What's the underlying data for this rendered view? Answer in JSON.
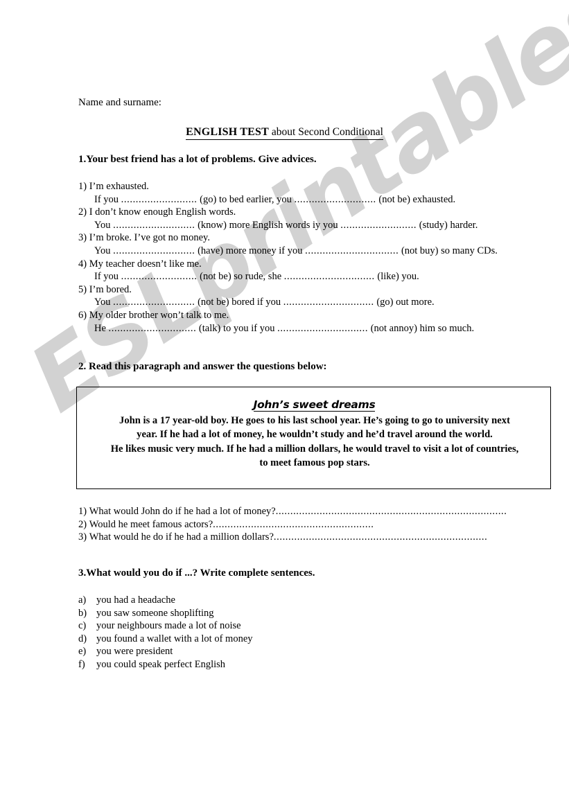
{
  "page": {
    "name_field_label": "Name and surname:",
    "watermark": "ESLprintables.com"
  },
  "title": {
    "strong": "ENGLISH TEST",
    "light": " about Second Conditional"
  },
  "exercise1": {
    "heading": "1.Your best friend has a lot of problems. Give advices.",
    "items": [
      {
        "number": "1)",
        "problem": "I’m exhausted.",
        "answer_pre": "If you ",
        "dots1": "..........................",
        "answer_mid": " (go) to bed earlier, you ",
        "dots2": "............................",
        "answer_post": " (not be) exhausted."
      },
      {
        "number": "2)",
        "problem": "I don’t know enough English words.",
        "answer_pre": "You ",
        "dots1": "............................",
        "answer_mid": " (know) more English words iy you ",
        "dots2": "..........................",
        "answer_post": " (study)   harder."
      },
      {
        "number": "3)",
        "problem": "I’m broke. I’ve got no money.",
        "answer_pre": "You ",
        "dots1": "............................",
        "answer_mid": " (have) more money if you ",
        "dots2": "................................",
        "answer_post": " (not buy) so many CDs."
      },
      {
        "number": "4)",
        "problem": "My teacher doesn’t like me.",
        "answer_pre": "If you ",
        "dots1": "..........................",
        "answer_mid": " (not be) so rude, she ",
        "dots2": "...............................",
        "answer_post": " (like) you."
      },
      {
        "number": "5)",
        "problem": "I’m bored.",
        "answer_pre": "You ",
        "dots1": "............................",
        "answer_mid": " (not be) bored if you ",
        "dots2": "...............................",
        "answer_post": " (go) out more."
      },
      {
        "number": "6)",
        "problem": "My older brother won’t talk to me.",
        "answer_pre": "He ",
        "dots1": "..............................",
        "answer_mid": " (talk) to you if you ",
        "dots2": "...............................",
        "answer_post": " (not annoy) him so much."
      }
    ]
  },
  "exercise2": {
    "heading": "2.   Read this paragraph and answer the questions below:",
    "box": {
      "title": "John’s  sweet dreams",
      "paragraph": [
        "John is a 17 year-old boy. He goes to his last school year. He’s going to go to university next year. If he had a lot of money, he wouldn’t study and he’d travel around the world.",
        "He likes music very much. If he had a million dollars, he would travel to visit a lot of countries, to meet famous pop stars."
      ]
    },
    "questions": [
      {
        "number": "1)",
        "text": "What would John do if he had a lot of money?  ",
        "dots": "..............................................................................."
      },
      {
        "number": "2)",
        "text": "Would he meet famous actors?        ",
        "dots": "......................................................."
      },
      {
        "number": "3)",
        "text": "What would he do if he had a million dollars?  ",
        "dots": "........................................................................."
      }
    ]
  },
  "exercise3": {
    "heading": "3.What would you do if ...? Write complete sentences.",
    "items": [
      {
        "letter": "a)",
        "text": "you had a headache"
      },
      {
        "letter": "b)",
        "text": "you saw someone shoplifting"
      },
      {
        "letter": "c)",
        "text": "your neighbours made a lot of noise"
      },
      {
        "letter": "d)",
        "text": "you found a wallet with a lot of money"
      },
      {
        "letter": "e)",
        "text": "you were president"
      },
      {
        "letter": "f)",
        "text": "you could speak perfect English"
      }
    ]
  },
  "colors": {
    "text": "#000000",
    "watermark": "#d2d2d2",
    "border": "#000000"
  }
}
